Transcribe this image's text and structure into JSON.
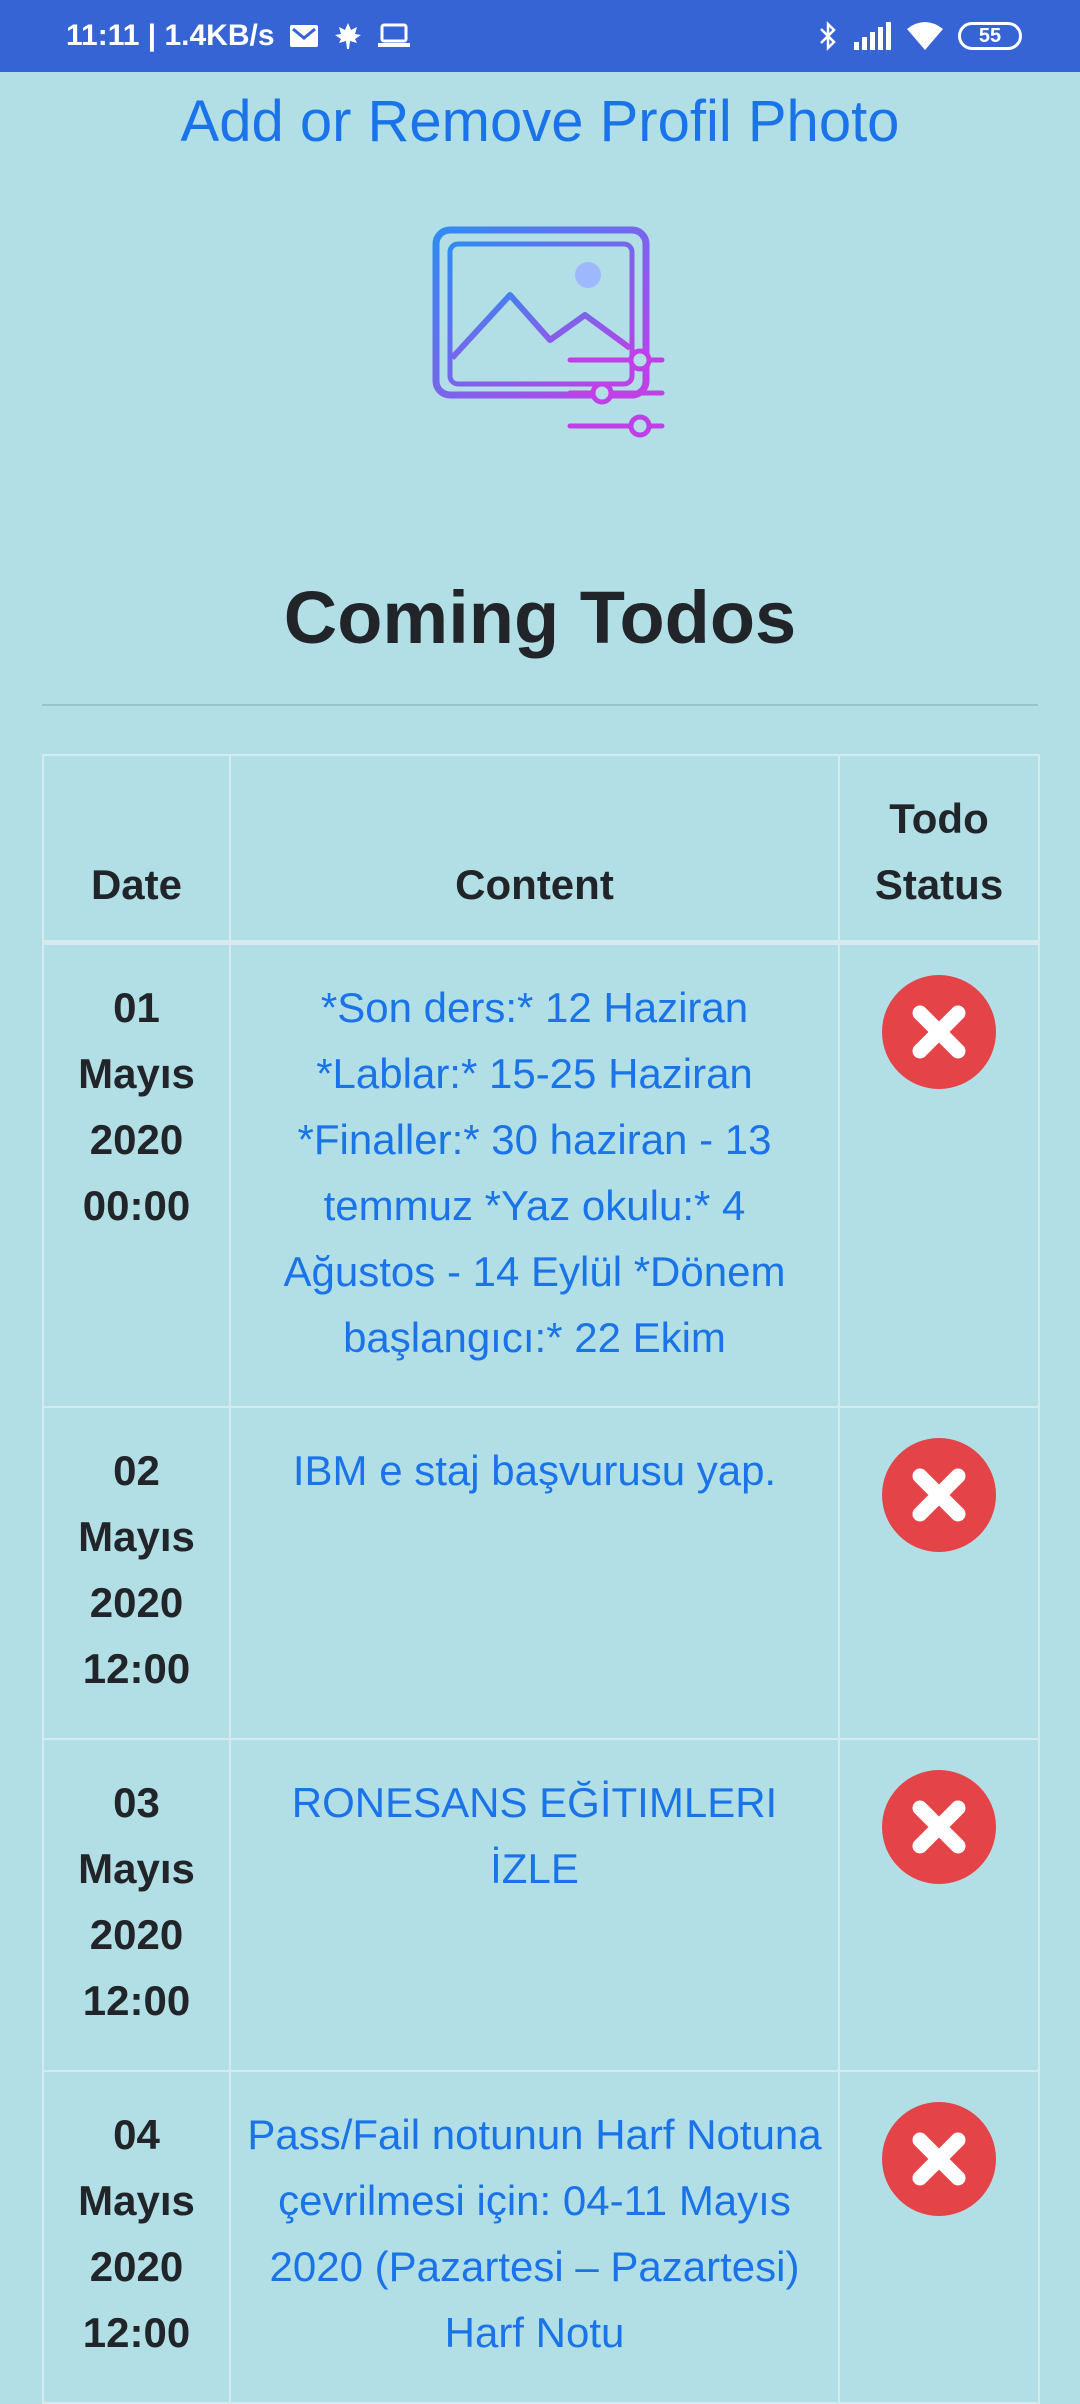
{
  "status_bar": {
    "time_speed": "11:11 | 1.4KB/s",
    "battery": "55",
    "icons": [
      "mail-icon",
      "maple-leaf-icon",
      "laptop-icon",
      "bluetooth-icon",
      "signal-icon",
      "wifi-icon",
      "battery-icon"
    ]
  },
  "profile": {
    "link_text": "Add or Remove Profil Photo",
    "image_icon": "image-settings-icon"
  },
  "section": {
    "title": "Coming Todos"
  },
  "table": {
    "headers": {
      "date": "Date",
      "content": "Content",
      "status": "Todo Status"
    },
    "status_icon": "close-circle-icon",
    "status_color": "#e44447",
    "rows": [
      {
        "day": "01",
        "month": "Mayıs",
        "year": "2020",
        "time": "00:00",
        "content": "*Son ders:* 12 Haziran *Lablar:* 15-25 Haziran *Finaller:* 30 haziran - 13 temmuz *Yaz okulu:* 4 Ağustos - 14 Eylül *Dönem başlangıcı:* 22 Ekim"
      },
      {
        "day": "02",
        "month": "Mayıs",
        "year": "2020",
        "time": "12:00",
        "content": "IBM e staj başvurusu yap."
      },
      {
        "day": "03",
        "month": "Mayıs",
        "year": "2020",
        "time": "12:00",
        "content": "RONESANS EĞİTIMLERI İZLE"
      },
      {
        "day": "04",
        "month": "Mayıs",
        "year": "2020",
        "time": "12:00",
        "content": "Pass/Fail notunun Harf Notuna çevrilmesi için: 04-11 Mayıs 2020 (Pazartesi – Pazartesi) Harf Notu"
      }
    ]
  },
  "colors": {
    "status_bar": "#3664d4",
    "background": "#b1dfe5",
    "link": "#1a73e8",
    "text": "#212529"
  }
}
